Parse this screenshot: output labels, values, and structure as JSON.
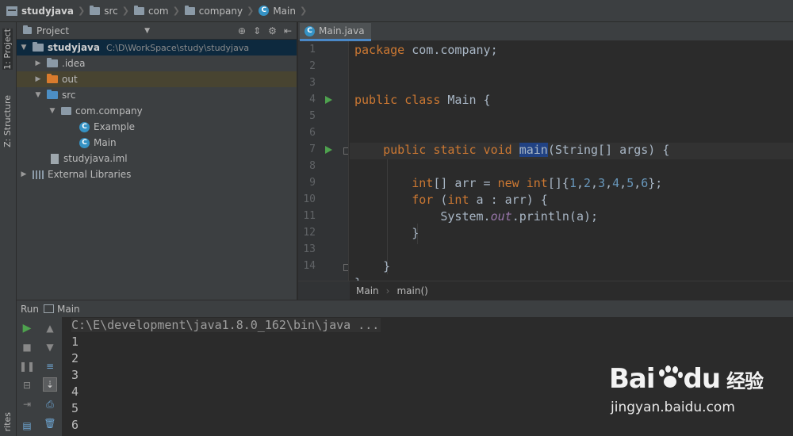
{
  "navbar": {
    "crumbs": [
      "studyjava",
      "src",
      "com",
      "company",
      "Main"
    ]
  },
  "left_strip": {
    "tabs": [
      "1: Project",
      "Z: Structure",
      "rites"
    ]
  },
  "project_panel": {
    "title": "Project",
    "tree": [
      {
        "label": "studyjava",
        "path": "C:\\D\\WorkSpace\\study\\studyjava"
      },
      {
        "label": ".idea"
      },
      {
        "label": "out"
      },
      {
        "label": "src"
      },
      {
        "label": "com.company"
      },
      {
        "label": "Example"
      },
      {
        "label": "Main"
      },
      {
        "label": "studyjava.iml"
      },
      {
        "label": "External Libraries"
      }
    ]
  },
  "editor": {
    "tab_label": "Main.java",
    "line_numbers": [
      "1",
      "2",
      "3",
      "4",
      "5",
      "6",
      "7",
      "8",
      "9",
      "10",
      "11",
      "12",
      "13",
      "14"
    ],
    "breadcrumbs": [
      "Main",
      "main()"
    ]
  },
  "run_panel": {
    "title": "Run",
    "config": "Main",
    "console_lines": [
      "C:\\E\\development\\java1.8.0_162\\bin\\java ...",
      "1",
      "2",
      "3",
      "4",
      "5",
      "6"
    ]
  },
  "watermark": {
    "brand_a": "Bai",
    "brand_b": "du",
    "brand_cn": "经验",
    "url": "jingyan.baidu.com"
  },
  "colors": {
    "keyword": "#cc7832",
    "number": "#6897bb",
    "field": "#9876aa",
    "text": "#a9b7c6",
    "selection": "#214283",
    "run_green": "#4ea24e"
  }
}
